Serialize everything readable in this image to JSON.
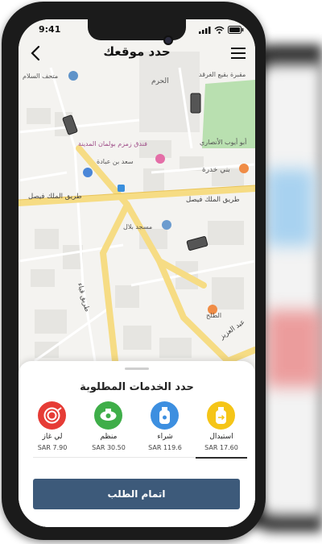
{
  "status": {
    "time": "9:41"
  },
  "header": {
    "title": "حدد موقعك"
  },
  "map": {
    "labels": {
      "museum": "متحف السلام",
      "haram": "الحرم",
      "cemetery": "مقبرة بقيع الغرقد",
      "ayyub": "أبو أيوب الأنصاري",
      "hotel": "فندق زمزم بولمان المدينة",
      "saad": "سعد بن عبادة",
      "bani": "بني خدرة",
      "faisal_left": "طريق الملك فيصل",
      "faisal_right": "طريق الملك فيصل",
      "bilal": "مسجد بلال",
      "qubaa": "طريق قباء",
      "tala": "الطلح",
      "abdulaziz": "عبد العزيز"
    }
  },
  "sheet": {
    "title": "حدد الخدمات المطلوبة",
    "services": [
      {
        "name": "لي غاز",
        "price": "SAR 7.90",
        "icon": "hose-icon",
        "color": "#e63c36"
      },
      {
        "name": "منظم",
        "price": "SAR 30.50",
        "icon": "regulator-icon",
        "color": "#3fae49"
      },
      {
        "name": "شراء",
        "price": "SAR 119.6",
        "icon": "cylinder-icon",
        "color": "#3d8fe0"
      },
      {
        "name": "استبدال",
        "price": "SAR 17.60",
        "icon": "cylinder-exchange-icon",
        "color": "#f5c518"
      }
    ],
    "selected_index": 3,
    "submit_label": "اتمام الطلب"
  }
}
